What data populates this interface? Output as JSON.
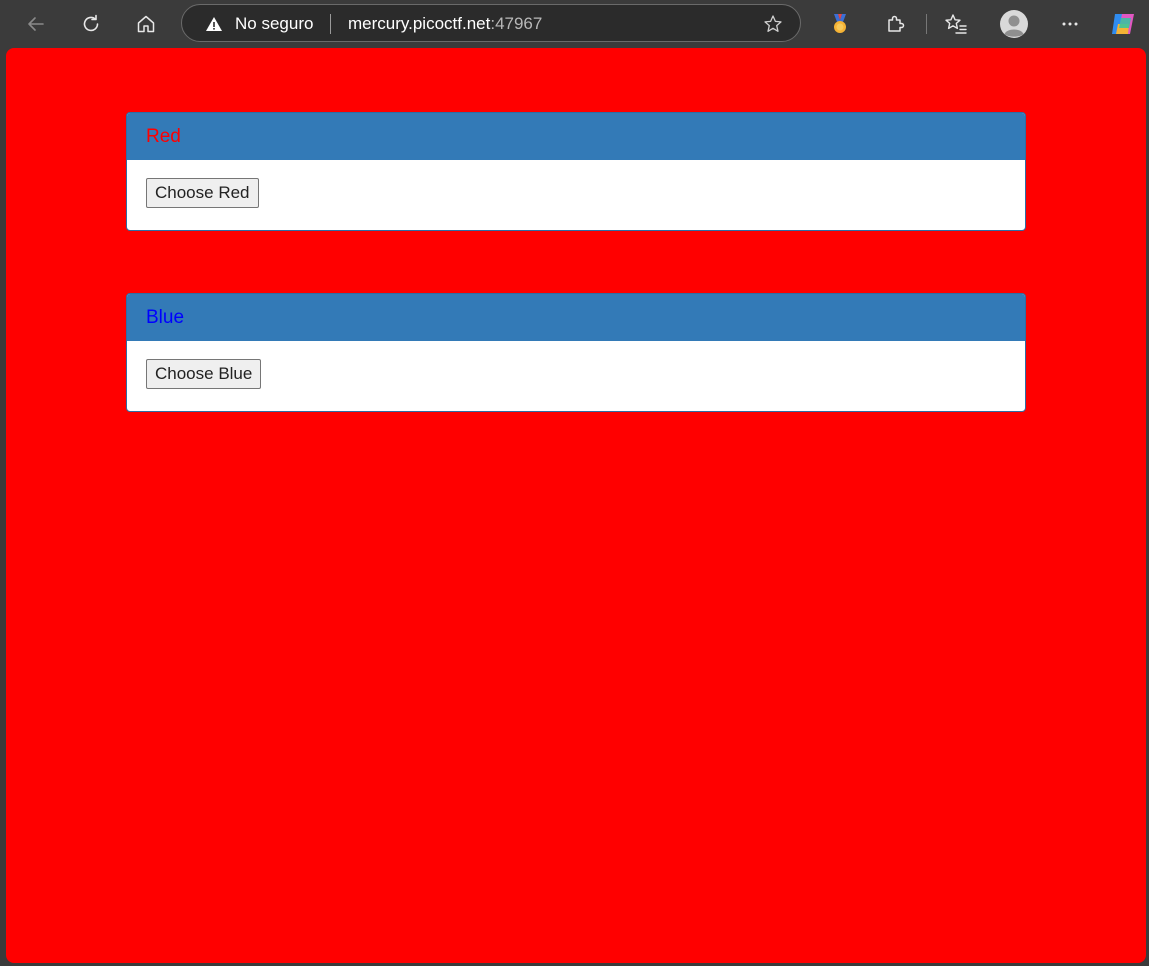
{
  "browser": {
    "security_label": "No seguro",
    "url_host": "mercury.picoctf.net",
    "url_port": ":47967"
  },
  "page": {
    "background_color": "#ff0000",
    "panels": [
      {
        "title": "Red",
        "title_color": "#ff0000",
        "button_label": "Choose Red"
      },
      {
        "title": "Blue",
        "title_color": "#0000ff",
        "button_label": "Choose Blue"
      }
    ]
  },
  "icons": {
    "back": "back-arrow-icon",
    "reload": "reload-icon",
    "home": "home-icon",
    "warning": "warning-icon",
    "star": "star-icon",
    "rewards": "rewards-medal-icon",
    "extensions": "puzzle-icon",
    "favorites": "favorites-icon",
    "profile": "avatar-icon",
    "menu": "more-icon",
    "copilot": "copilot-icon"
  }
}
